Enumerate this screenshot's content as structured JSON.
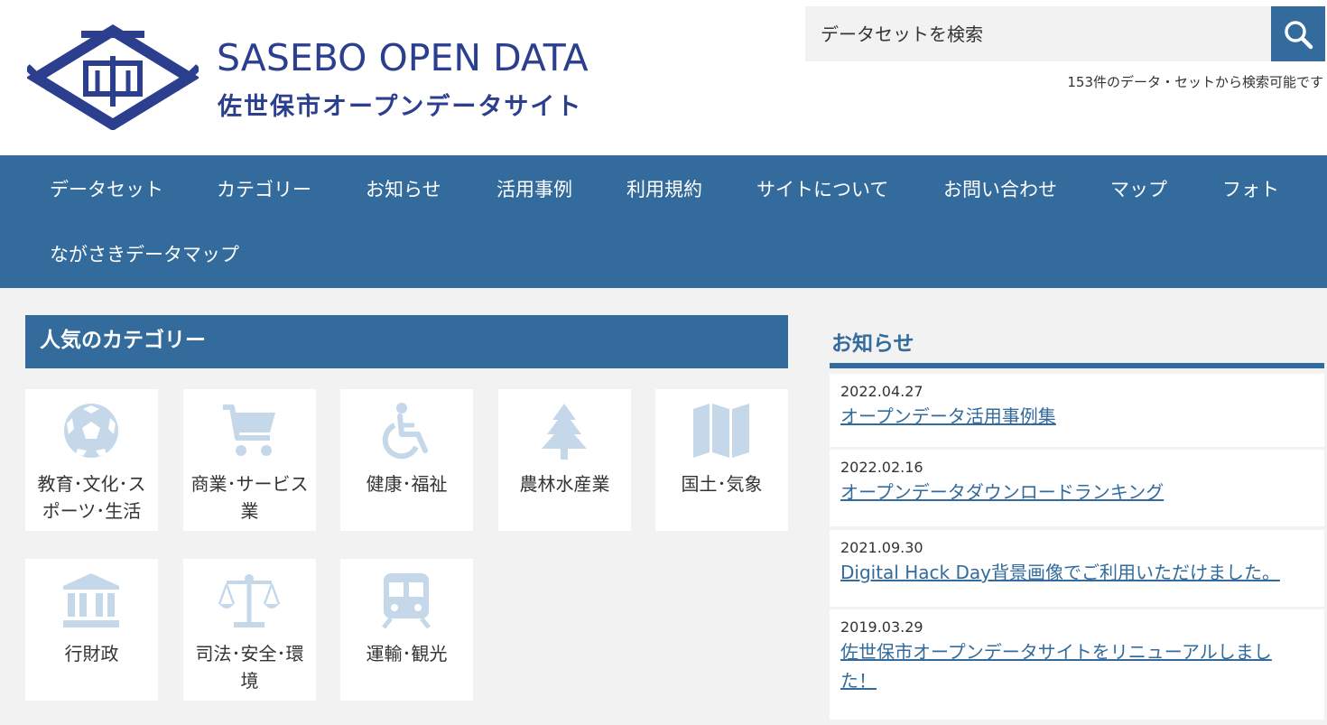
{
  "header": {
    "logo_en": "SASEBO OPEN DATA",
    "logo_ja": "佐世保市オープンデータサイト",
    "search_placeholder": "データセットを検索",
    "search_note": "153件のデータ・セットから検索可能です"
  },
  "nav": {
    "items": [
      "データセット",
      "カテゴリー",
      "お知らせ",
      "活用事例",
      "利用規約",
      "サイトについて",
      "お問い合わせ",
      "マップ",
      "フォト",
      "ながさきデータマップ"
    ]
  },
  "categories": {
    "title": "人気のカテゴリー",
    "items": [
      {
        "label": "教育･文化･スポーツ･生活",
        "icon": "soccer-ball-icon"
      },
      {
        "label": "商業･サービス業",
        "icon": "shopping-cart-icon"
      },
      {
        "label": "健康･福祉",
        "icon": "wheelchair-icon"
      },
      {
        "label": "農林水産業",
        "icon": "tree-icon"
      },
      {
        "label": "国土･気象",
        "icon": "map-icon"
      },
      {
        "label": "行財政",
        "icon": "government-building-icon"
      },
      {
        "label": "司法･安全･環境",
        "icon": "scales-icon"
      },
      {
        "label": "運輸･観光",
        "icon": "train-icon"
      }
    ]
  },
  "news": {
    "title": "お知らせ",
    "items": [
      {
        "date": "2022.04.27",
        "title": "オープンデータ活用事例集"
      },
      {
        "date": "2022.02.16",
        "title": "オープンデータダウンロードランキング"
      },
      {
        "date": "2021.09.30",
        "title": "Digital Hack Day背景画像でご利用いただけました。"
      },
      {
        "date": "2019.03.29",
        "title": "佐世保市オープンデータサイトをリニューアルしました！"
      }
    ]
  },
  "colors": {
    "primary": "#336b9c",
    "logo": "#2c3f8f",
    "icon": "#c5d8ea"
  }
}
